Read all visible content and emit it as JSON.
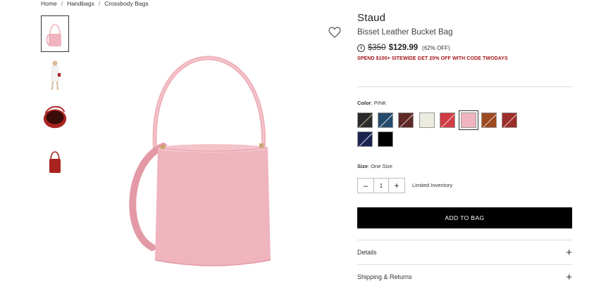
{
  "breadcrumb": {
    "items": [
      "Home",
      "Handbags",
      "Crossbody Bags"
    ],
    "separator": "/"
  },
  "product": {
    "brand": "Staud",
    "name": "Bisset Leather Bucket Bag",
    "original_price": "$350",
    "sale_price": "$129.99",
    "discount": "(62% OFF)",
    "promo": "SPEND $100+ SITEWIDE GET 20% OFF WITH CODE TWODAYS",
    "info_glyph": "i"
  },
  "color": {
    "label": "Color",
    "selected": "PINK",
    "swatches": [
      {
        "name": "black-tan",
        "colors": [
          "#2a2a2a",
          "#2a2a2a"
        ]
      },
      {
        "name": "navy-blue",
        "colors": [
          "#244a6b",
          "#244a6b"
        ]
      },
      {
        "name": "brown",
        "colors": [
          "#5e2a28",
          "#5e2a28"
        ]
      },
      {
        "name": "cream",
        "colors": [
          "#ecebdf",
          "#ecebdf"
        ]
      },
      {
        "name": "red",
        "colors": [
          "#cf3c43",
          "#cf3c43"
        ]
      },
      {
        "name": "pink",
        "colors": [
          "#efb4bd",
          "#efb4bd"
        ]
      },
      {
        "name": "cognac",
        "colors": [
          "#9c4a22",
          "#9c4a22"
        ]
      },
      {
        "name": "rust",
        "colors": [
          "#9c2e2a",
          "#9c2e2a"
        ]
      },
      {
        "name": "dark-navy",
        "colors": [
          "#1b2350",
          "#1b2350"
        ]
      },
      {
        "name": "black",
        "colors": [
          "#000000",
          "#000000"
        ]
      }
    ],
    "selected_index": 5
  },
  "size": {
    "label": "Size",
    "value": "One Size"
  },
  "quantity": {
    "value": "1",
    "minus": "–",
    "plus": "+",
    "stock_note": "Limited Inventory"
  },
  "actions": {
    "add_to_bag": "ADD TO BAG"
  },
  "accordions": [
    {
      "label": "Details",
      "icon": "+"
    },
    {
      "label": "Shipping & Returns",
      "icon": "+"
    }
  ],
  "colors": {
    "promo_red": "#a3151a",
    "bag_pink": "#efb4bd",
    "button_black": "#000000"
  }
}
